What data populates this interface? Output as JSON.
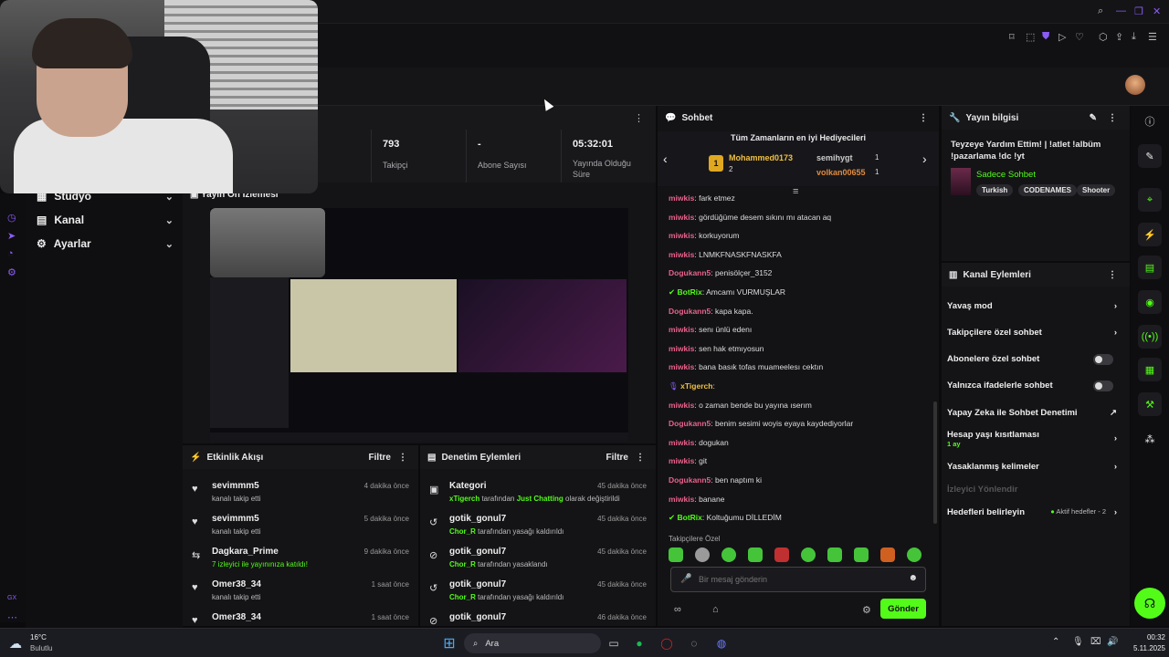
{
  "stats": {
    "items": [
      {
        "value": "793",
        "label": "Takipçi"
      },
      {
        "value": "-",
        "label": "Abone Sayısı"
      },
      {
        "value": "05:32:01",
        "label": "Yayında Olduğu Süre"
      }
    ]
  },
  "leftnav": {
    "items": [
      {
        "label": "Stüdyo"
      },
      {
        "label": "Kanal"
      },
      {
        "label": "Ayarlar"
      }
    ],
    "footer": "GX"
  },
  "preview": {
    "title": "Yayın Ön İzlemesi"
  },
  "activity": {
    "title": "Etkinlik Akışı",
    "filter": "Filtre",
    "rows": [
      {
        "user": "sevimmm5",
        "text": "kanalı takip etti",
        "time": "4 dakika önce"
      },
      {
        "user": "sevimmm5",
        "text": "kanalı takip etti",
        "time": "5 dakika önce"
      },
      {
        "user": "Dagkara_Prime",
        "text": "7 izleyici ile yayınınıza katıldı!",
        "time": "9 dakika önce"
      },
      {
        "user": "Omer38_34",
        "text": "kanalı takip etti",
        "time": "1 saat önce"
      },
      {
        "user": "Omer38_34",
        "text": "",
        "time": "1 saat önce"
      }
    ]
  },
  "moderation": {
    "title": "Denetim Eylemleri",
    "filter": "Filtre",
    "rows": [
      {
        "title": "Kategori",
        "actor": "xTigerch",
        "middle": "tarafından",
        "highlight": "Just Chatting",
        "tail": "olarak değiştirildi",
        "time": "45 dakika önce"
      },
      {
        "title": "gotik_gonul7",
        "actor": "Chor_R",
        "middle": "tarafından yasağı kaldırıldı",
        "highlight": "",
        "tail": "",
        "time": "45 dakika önce"
      },
      {
        "title": "gotik_gonul7",
        "actor": "Chor_R",
        "middle": "tarafından yasaklandı",
        "highlight": "",
        "tail": "",
        "time": "45 dakika önce"
      },
      {
        "title": "gotik_gonul7",
        "actor": "Chor_R",
        "middle": "tarafından yasağı kaldırıldı",
        "highlight": "",
        "tail": "",
        "time": "45 dakika önce"
      },
      {
        "title": "gotik_gonul7",
        "actor": "",
        "middle": "",
        "highlight": "",
        "tail": "",
        "time": "46 dakika önce"
      }
    ]
  },
  "chat": {
    "title": "Sohbet",
    "gifters_title": "Tüm Zamanların en iyi Hediyecileri",
    "gifters": [
      {
        "name": "Mohammed0173",
        "count": "2"
      },
      {
        "name": "semihygt",
        "count": "1"
      },
      {
        "name": "volkan00655",
        "count": "1"
      }
    ],
    "messages": [
      {
        "user": "miwkis",
        "text": "fark etmez",
        "color": "pink"
      },
      {
        "user": "miwkis",
        "text": "gördüğüme desem sıkını mı atacan aq",
        "color": "pink"
      },
      {
        "user": "miwkis",
        "text": "korkuyorum",
        "color": "pink"
      },
      {
        "user": "miwkis",
        "text": "LNMKFNASKFNASKFA",
        "color": "pink"
      },
      {
        "user": "Dogukann5",
        "text": "penisölçer_3152",
        "color": "pink"
      },
      {
        "user": "BotRix",
        "text": "Amcamı VURMUŞLAR",
        "color": "green"
      },
      {
        "user": "Dogukann5",
        "text": "kapa kapa.",
        "color": "pink"
      },
      {
        "user": "miwkis",
        "text": "senı ünlü edenı",
        "color": "pink"
      },
      {
        "user": "miwkis",
        "text": "sen hak etmıyosun",
        "color": "pink"
      },
      {
        "user": "miwkis",
        "text": "bana basık tofas muameelesı cektın",
        "color": "pink"
      },
      {
        "user": "xTigerch",
        "text": "",
        "color": "gold"
      },
      {
        "user": "miwkis",
        "text": "o zaman bende bu yayına ıserım",
        "color": "pink"
      },
      {
        "user": "Dogukann5",
        "text": "benim sesimi woyis eyaya kaydediyorlar",
        "color": "pink"
      },
      {
        "user": "miwkis",
        "text": "dogukan",
        "color": "pink"
      },
      {
        "user": "miwkis",
        "text": "git",
        "color": "pink"
      },
      {
        "user": "Dogukann5",
        "text": "ben naptım ki",
        "color": "pink"
      },
      {
        "user": "miwkis",
        "text": "banane",
        "color": "pink"
      },
      {
        "user": "BotRix",
        "text": "Koltuğumu DİLLEDİM",
        "color": "green"
      }
    ],
    "emote_section": "Takipçilere Özel",
    "input_placeholder": "Bir mesaj gönderin",
    "send_label": "Gönder"
  },
  "info": {
    "title": "Yayın bilgisi",
    "stream_title": "Teyzeye Yardım Ettim! | !atlet !albüm !pazarlama !dc !yt",
    "category": "Sadece Sohbet",
    "tags": [
      "Turkish",
      "CODENAMES",
      "Shooter"
    ]
  },
  "actions": {
    "title": "Kanal Eylemleri",
    "items": [
      {
        "label": "Yavaş mod",
        "kind": "chevron"
      },
      {
        "label": "Takipçilere özel sohbet",
        "kind": "chevron"
      },
      {
        "label": "Abonelere özel sohbet",
        "kind": "toggle"
      },
      {
        "label": "Yalnızca ifadelerle sohbet",
        "kind": "toggle"
      },
      {
        "label": "Yapay Zeka ile Sohbet Denetimi",
        "kind": "external"
      },
      {
        "label": "Hesap yaşı kısıtlaması",
        "kind": "chevron",
        "sub": "1 ay"
      },
      {
        "label": "Yasaklanmış kelimeler",
        "kind": "chevron"
      },
      {
        "label": "İzleyici Yönlendir",
        "kind": "disabled"
      },
      {
        "label": "Hedefleri belirleyin",
        "kind": "chevron",
        "badge": "Aktif hedefler - 2"
      }
    ]
  },
  "taskbar": {
    "weather_temp": "16°C",
    "weather_desc": "Bulutlu",
    "search": "Ara",
    "time": "00:32",
    "date": "5.11.2025"
  },
  "colors": {
    "accent": "#53fc18",
    "pink": "#e8628a",
    "gold": "#f0c040"
  }
}
